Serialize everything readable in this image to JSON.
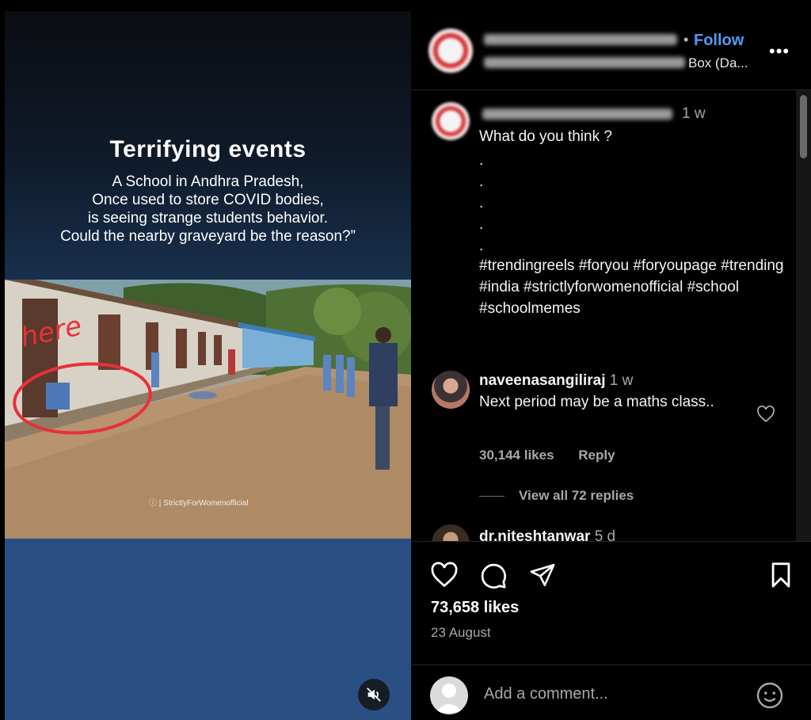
{
  "reel": {
    "title": "Terrifying events",
    "subtitle_lines": [
      "A School in Andhra Pradesh,",
      "Once used to store COVID bodies,",
      "is seeing strange students behavior.",
      "Could the nearby graveyard be the reason?”"
    ],
    "annotation": "here",
    "watermark": "ⓘ | StrictlyForWomenofficial",
    "mute_icon": "speaker-muted-icon"
  },
  "header": {
    "separator": "•",
    "follow_label": "Follow",
    "audio_suffix": "Box (Da...",
    "more_label": "•••"
  },
  "owner_comment": {
    "time": "1 w",
    "caption": "What do you think ?",
    "dots": [
      ".",
      ".",
      ".",
      ".",
      "."
    ],
    "hashtags": "#trendingreels #foryou #foryoupage #trending #india #strictlyforwomenofficial #school #schoolmemes"
  },
  "comments": [
    {
      "username": "naveenasangiliraj",
      "time": "1 w",
      "text": "Next period may be a maths class..",
      "likes": "30,144 likes",
      "reply_label": "Reply",
      "view_replies": "View all 72 replies"
    },
    {
      "username": "dr.niteshtanwar",
      "time": "5 d"
    }
  ],
  "post": {
    "likes": "73,658 likes",
    "date": "23 August"
  },
  "comment_box": {
    "placeholder": "Add a comment..."
  },
  "colors": {
    "accent_blue": "#4f9cf6",
    "background": "#000000",
    "secondary_text": "#a8a8a8",
    "annotation_red": "#e8303a"
  }
}
